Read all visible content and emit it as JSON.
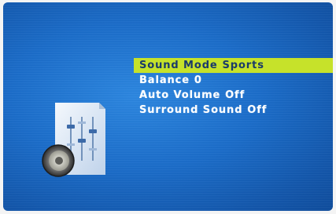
{
  "menu": {
    "items": [
      {
        "label": "Sound Mode",
        "value": "Sports",
        "selected": true
      },
      {
        "label": "Balance",
        "value": "0",
        "selected": false
      },
      {
        "label": "Auto Volume",
        "value": "Off",
        "selected": false
      },
      {
        "label": "Surround Sound",
        "value": "Off",
        "selected": false
      }
    ]
  },
  "icon": {
    "name": "sound-settings-icon"
  },
  "colors": {
    "background": "#1a6cc9",
    "highlight": "#c6e22a",
    "text": "#ffffff",
    "selected_text": "#1a3a6a"
  }
}
